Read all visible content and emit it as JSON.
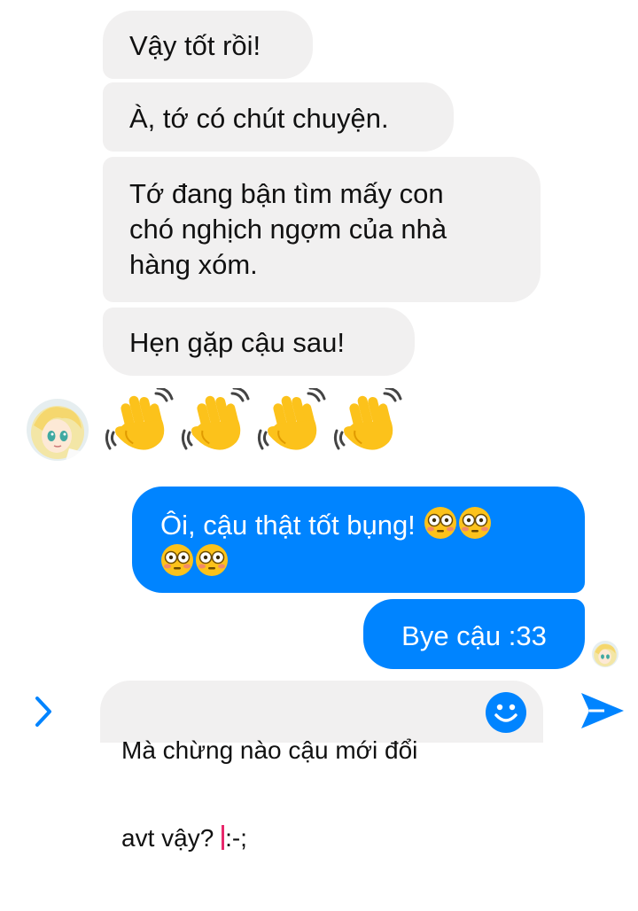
{
  "conversation": {
    "messages": [
      {
        "sender": "contact",
        "text": "Vậy tốt rồi!"
      },
      {
        "sender": "contact",
        "text": "À, tớ có chút chuyện."
      },
      {
        "sender": "contact",
        "line1": "Tớ đang bận tìm mấy con",
        "line2": "chó nghịch ngợm của nhà",
        "line3": "hàng xóm."
      },
      {
        "sender": "contact",
        "text": "Hẹn gặp cậu sau!"
      },
      {
        "sender": "contact",
        "emoji": "waving-hand-icon",
        "count": 4
      },
      {
        "sender": "me",
        "text": "Ôi, cậu thật tốt bụng!",
        "emoji": "flushed-face-icon",
        "emoji_count": 4
      },
      {
        "sender": "me",
        "text": "Bye cậu :33"
      }
    ]
  },
  "composer": {
    "line1": "Mà chừng nào cậu mới đổi",
    "line2_before_caret": "avt vậy? ",
    "line2_after_caret": ":-;"
  },
  "icons": {
    "expand": "chevron-right-icon",
    "emoji": "smiley-icon",
    "send": "send-icon"
  },
  "colors": {
    "accent": "#0084ff",
    "incoming_bubble": "#f1f0f0",
    "wave_emoji": "#fcc21b"
  }
}
